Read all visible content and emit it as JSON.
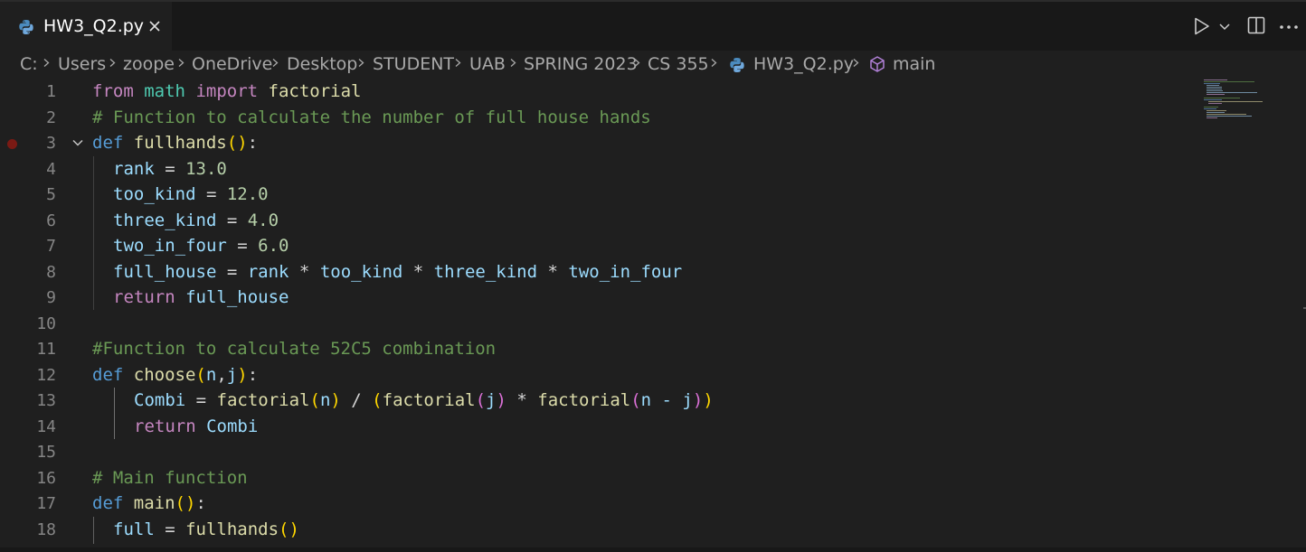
{
  "tab": {
    "label": "HW3_Q2.py",
    "close_icon": "close-icon"
  },
  "actions": {
    "run_icon": "play-icon",
    "dropdown_icon": "chevron-down-icon",
    "split_icon": "split-editor-icon",
    "more_icon": "ellipsis-icon"
  },
  "breadcrumb": [
    "C:",
    "Users",
    "zoope",
    "OneDrive",
    "Desktop",
    "STUDENT",
    "UAB",
    "SPRING 2023",
    "CS 355",
    "HW3_Q2.py",
    "main"
  ],
  "line_numbers": [
    "1",
    "2",
    "3",
    "4",
    "5",
    "6",
    "7",
    "8",
    "9",
    "10",
    "11",
    "12",
    "13",
    "14",
    "15",
    "16",
    "17",
    "18"
  ],
  "code": {
    "l1": [
      "from",
      " ",
      "math",
      " ",
      "import",
      " ",
      "factorial"
    ],
    "l2": [
      "# Function to calculate the number of full house hands"
    ],
    "l3": [
      "def",
      " ",
      "fullhands",
      "(",
      ")",
      ":"
    ],
    "l4": [
      "rank",
      " = ",
      "13.0"
    ],
    "l5": [
      "too_kind",
      " = ",
      "12.0"
    ],
    "l6": [
      "three_kind",
      " = ",
      "4.0"
    ],
    "l7": [
      "two_in_four",
      " = ",
      "6.0"
    ],
    "l8": [
      "full_house",
      " = ",
      "rank",
      " * ",
      "too_kind",
      " * ",
      "three_kind",
      " * ",
      "two_in_four"
    ],
    "l9": [
      "return",
      " ",
      "full_house"
    ],
    "l11": [
      "#Function to calculate 52C5 combination"
    ],
    "l12": [
      "def",
      " ",
      "choose",
      "(",
      "n",
      ",",
      "j",
      ")",
      ":"
    ],
    "l13": [
      "Combi",
      " = ",
      "factorial",
      "(",
      "n",
      ")",
      " / ",
      "(",
      "factorial",
      "(",
      "j",
      ")",
      " * ",
      "factorial",
      "(",
      "n - j",
      ")",
      ")"
    ],
    "l14": [
      "return",
      " ",
      "Combi"
    ],
    "l16": [
      "# Main function"
    ],
    "l17": [
      "def",
      " ",
      "main",
      "(",
      ")",
      ":"
    ],
    "l18": [
      "full",
      " = ",
      "fullhands",
      "(",
      ")"
    ]
  },
  "colors": {
    "background": "#1f1f1f",
    "tabbar": "#181818",
    "keyword": "#569cd6",
    "control": "#c586c0",
    "function": "#dcdcaa",
    "variable": "#9cdcfe",
    "number": "#b5cea8",
    "comment": "#6a9955",
    "breakpoint": "#7a1a14"
  }
}
